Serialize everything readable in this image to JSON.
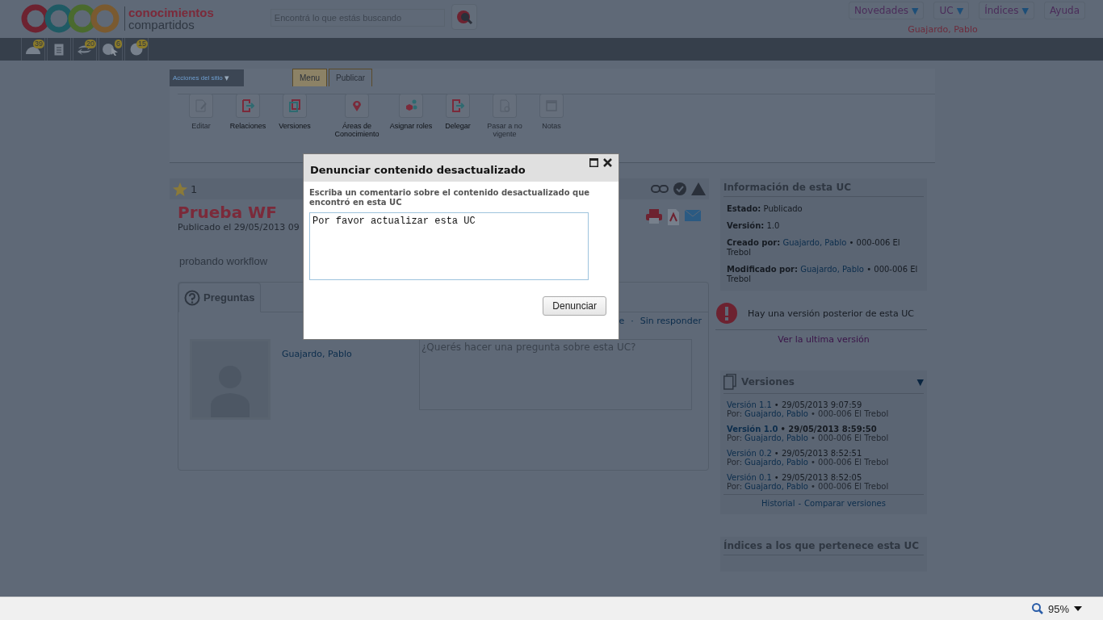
{
  "header": {
    "logo": {
      "line_1": "conocimientos",
      "line_2": "compartidos"
    },
    "search": {
      "placeholder": "Encontrá lo que estás buscando"
    },
    "nav": [
      {
        "label": "Novedades",
        "caret": "▼"
      },
      {
        "label": "UC",
        "caret": "▼"
      },
      {
        "label": "Índices",
        "caret": "▼"
      },
      {
        "label": "Ayuda"
      }
    ],
    "user": "Guajardo, Pablo"
  },
  "toolbar": [
    {
      "kind": "gauge",
      "badge": "39"
    },
    {
      "kind": "document"
    },
    {
      "kind": "exchange",
      "badge": "20"
    },
    {
      "kind": "question-pointer",
      "badge": "6"
    },
    {
      "kind": "question",
      "badge": "15"
    }
  ],
  "site_actions": {
    "label": "Acciones del sitio",
    "caret": "▾"
  },
  "tabs": [
    {
      "label": "Menu",
      "selected": true
    },
    {
      "label": "Publicar",
      "selected": false
    }
  ],
  "ribbon": [
    {
      "kind": "edit",
      "label": "Editar",
      "disabled": true
    },
    {
      "kind": "relations",
      "label": "Relaciones",
      "disabled": false
    },
    {
      "kind": "versions",
      "label": "Versiones",
      "disabled": false
    },
    {
      "kind": "areas",
      "label": "Áreas de Conocimiento",
      "disabled": false
    },
    {
      "kind": "roles",
      "label": "Asignar roles",
      "disabled": false
    },
    {
      "kind": "delegate",
      "label": "Delegar",
      "disabled": false
    },
    {
      "kind": "expire",
      "label": "Pasar a no vigente",
      "disabled": true
    },
    {
      "kind": "notes",
      "label": "Notas",
      "disabled": true
    }
  ],
  "document": {
    "rating_count": "1",
    "title": "Prueba WF",
    "published": "Publicado el 29/05/2013 09",
    "summary": "probando workflow"
  },
  "questions": {
    "tab": "Preguntas",
    "filters": [
      "e",
      "Sin responder"
    ],
    "filter_separator": "·",
    "author": "Guajardo, Pablo",
    "placeholder": "¿Querés hacer una pregunta sobre esta UC?"
  },
  "info": {
    "title": "Información de esta UC",
    "fields": [
      {
        "label": "Estado:",
        "value": "Publicado"
      },
      {
        "label": "Versión:",
        "value": "1.0"
      },
      {
        "label": "Creado por:",
        "link": "Guajardo, Pablo",
        "value": "• 000-006 El Trebol"
      },
      {
        "label": "Modificado por:",
        "link": "Guajardo, Pablo",
        "value": "• 000-006 El Trebol"
      }
    ]
  },
  "alert": {
    "text": "Hay una versión posterior de esta UC",
    "link": "Ver la ultima versión"
  },
  "versions": {
    "title": "Versiones",
    "caret": "▼",
    "items": [
      {
        "version": "Versión 1.1",
        "date": "• 29/05/2013 9:07:59",
        "by": "Por:",
        "author": "Guajardo, Pablo",
        "office": "• 000-006 El Trebol",
        "current": false
      },
      {
        "version": "Versión 1.0",
        "date": "• 29/05/2013 8:59:50",
        "by": "Por:",
        "author": "Guajardo, Pablo",
        "office": "• 000-006 El Trebol",
        "current": true
      },
      {
        "version": "Versión 0.2",
        "date": "• 29/05/2013 8:52:51",
        "by": "Por:",
        "author": "Guajardo, Pablo",
        "office": "• 000-006 El Trebol",
        "current": false
      },
      {
        "version": "Versión 0.1",
        "date": "• 29/05/2013 8:52:05",
        "by": "Por:",
        "author": "Guajardo, Pablo",
        "office": "• 000-006 El Trebol",
        "current": false
      }
    ],
    "links": [
      "Historial",
      "Comparar versiones"
    ],
    "separator": "-"
  },
  "indices": {
    "title": "Índices a los que pertenece esta UC"
  },
  "dialog": {
    "title": "Denunciar contenido desactualizado",
    "prompt": "Escriba un comentario sobre el contenido desactualizado que encontró en esta UC",
    "value": "Por favor actualizar esta UC",
    "button": "Denunciar"
  },
  "status_bar": {
    "zoom": "95%"
  }
}
